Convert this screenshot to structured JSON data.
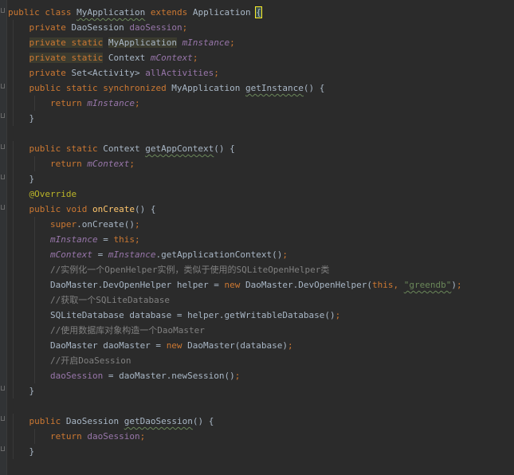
{
  "editor": {
    "theme_colors": {
      "background": "#2b2b2b",
      "keyword": "#cc7832",
      "field": "#9876aa",
      "method": "#ffc66d",
      "string": "#6a8759",
      "comment": "#808080",
      "annotation": "#bbb529",
      "text": "#a9b7c6"
    },
    "lines": [
      [
        [
          "kw",
          "public"
        ],
        [
          "t",
          " "
        ],
        [
          "kw",
          "class"
        ],
        [
          "t",
          " "
        ],
        [
          "sq",
          "MyApplication"
        ],
        [
          "t",
          " "
        ],
        [
          "kw",
          "extends"
        ],
        [
          "t",
          " Application "
        ],
        [
          "caret",
          "{"
        ]
      ],
      [
        [
          "t",
          "    "
        ],
        [
          "kw",
          "private"
        ],
        [
          "t",
          " DaoSession "
        ],
        [
          "fld",
          "daoSession"
        ],
        [
          "kw",
          ";"
        ]
      ],
      [
        [
          "t",
          "    "
        ],
        [
          "kwhl",
          "private static"
        ],
        [
          "t",
          " "
        ],
        [
          "hl",
          "MyApplication"
        ],
        [
          "t",
          " "
        ],
        [
          "sfld",
          "mInstance"
        ],
        [
          "kw",
          ";"
        ]
      ],
      [
        [
          "t",
          "    "
        ],
        [
          "kwhl",
          "private static"
        ],
        [
          "t",
          " Context "
        ],
        [
          "sfld",
          "mContext"
        ],
        [
          "kw",
          ";"
        ]
      ],
      [
        [
          "t",
          "    "
        ],
        [
          "kw",
          "private"
        ],
        [
          "t",
          " Set<Activity> "
        ],
        [
          "fld",
          "allActivities"
        ],
        [
          "kw",
          ";"
        ]
      ],
      [
        [
          "t",
          "    "
        ],
        [
          "kw",
          "public static synchronized"
        ],
        [
          "t",
          " MyApplication "
        ],
        [
          "sq",
          "getInstance"
        ],
        [
          "t",
          "() {"
        ]
      ],
      [
        [
          "t",
          "        "
        ],
        [
          "kw",
          "return"
        ],
        [
          "t",
          " "
        ],
        [
          "sfld",
          "mInstance"
        ],
        [
          "kw",
          ";"
        ]
      ],
      [
        [
          "t",
          "    }"
        ]
      ],
      [
        [
          "t",
          ""
        ]
      ],
      [
        [
          "t",
          "    "
        ],
        [
          "kw",
          "public static"
        ],
        [
          "t",
          " Context "
        ],
        [
          "sq",
          "getAppContext"
        ],
        [
          "t",
          "() {"
        ]
      ],
      [
        [
          "t",
          "        "
        ],
        [
          "kw",
          "return"
        ],
        [
          "t",
          " "
        ],
        [
          "sfld",
          "mContext"
        ],
        [
          "kw",
          ";"
        ]
      ],
      [
        [
          "t",
          "    }"
        ]
      ],
      [
        [
          "t",
          "    "
        ],
        [
          "ann",
          "@Override"
        ]
      ],
      [
        [
          "t",
          "    "
        ],
        [
          "kw",
          "public void"
        ],
        [
          "t",
          " "
        ],
        [
          "fn",
          "onCreate"
        ],
        [
          "t",
          "() {"
        ]
      ],
      [
        [
          "t",
          "        "
        ],
        [
          "kw",
          "super"
        ],
        [
          "t",
          ".onCreate()"
        ],
        [
          "kw",
          ";"
        ]
      ],
      [
        [
          "t",
          "        "
        ],
        [
          "sfld",
          "mInstance"
        ],
        [
          "t",
          " = "
        ],
        [
          "kw",
          "this"
        ],
        [
          "kw",
          ";"
        ]
      ],
      [
        [
          "t",
          "        "
        ],
        [
          "sfld",
          "mContext"
        ],
        [
          "t",
          " = "
        ],
        [
          "sfld",
          "mInstance"
        ],
        [
          "t",
          ".getApplicationContext()"
        ],
        [
          "kw",
          ";"
        ]
      ],
      [
        [
          "t",
          "        "
        ],
        [
          "cm",
          "//实例化一个OpenHelper实例，类似于使用的SQLiteOpenHelper类"
        ]
      ],
      [
        [
          "t",
          "        DaoMaster.DevOpenHelper helper = "
        ],
        [
          "kw",
          "new"
        ],
        [
          "t",
          " DaoMaster.DevOpenHelper("
        ],
        [
          "kw",
          "this"
        ],
        [
          "kw",
          ","
        ],
        [
          "t",
          " "
        ],
        [
          "strsq",
          "\"greendb\""
        ],
        [
          "t",
          ")"
        ],
        [
          "kw",
          ";"
        ]
      ],
      [
        [
          "t",
          "        "
        ],
        [
          "cm",
          "//获取一个SQLiteDatabase"
        ]
      ],
      [
        [
          "t",
          "        SQLiteDatabase database = helper.getWritableDatabase()"
        ],
        [
          "kw",
          ";"
        ]
      ],
      [
        [
          "t",
          "        "
        ],
        [
          "cm",
          "//使用数据库对象构造一个DaoMaster"
        ]
      ],
      [
        [
          "t",
          "        DaoMaster daoMaster = "
        ],
        [
          "kw",
          "new"
        ],
        [
          "t",
          " DaoMaster(database)"
        ],
        [
          "kw",
          ";"
        ]
      ],
      [
        [
          "t",
          "        "
        ],
        [
          "cm",
          "//开启DoaSession"
        ]
      ],
      [
        [
          "t",
          "        "
        ],
        [
          "fld",
          "daoSession"
        ],
        [
          "t",
          " = daoMaster.newSession()"
        ],
        [
          "kw",
          ";"
        ]
      ],
      [
        [
          "t",
          "    }"
        ]
      ],
      [
        [
          "t",
          ""
        ]
      ],
      [
        [
          "t",
          "    "
        ],
        [
          "kw",
          "public"
        ],
        [
          "t",
          " DaoSession "
        ],
        [
          "sq",
          "getDaoSession"
        ],
        [
          "t",
          "() {"
        ]
      ],
      [
        [
          "t",
          "        "
        ],
        [
          "kw",
          "return"
        ],
        [
          "t",
          " "
        ],
        [
          "fld",
          "daoSession"
        ],
        [
          "kw",
          ";"
        ]
      ],
      [
        [
          "t",
          "    }"
        ]
      ]
    ]
  }
}
